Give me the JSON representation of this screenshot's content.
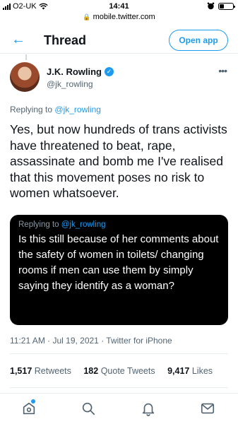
{
  "status_bar": {
    "carrier": "O2-UK",
    "time": "14:41"
  },
  "browser": {
    "url": "mobile.twitter.com"
  },
  "header": {
    "title": "Thread",
    "open_app_label": "Open app"
  },
  "tweet": {
    "author_name": "J.K. Rowling",
    "author_handle": "@jk_rowling",
    "replying_prefix": "Replying to",
    "replying_handle": "@jk_rowling",
    "text": "Yes, but now hundreds of trans activists have threatened to beat, rape, assassinate and bomb me I've realised that this movement poses no risk to women whatsoever.",
    "quoted": {
      "replying_prefix": "Replying to",
      "replying_handle": "@jk_rowling",
      "text": "Is this still because of her comments about the safety of women in toilets/ changing rooms if men can use them by simply saying they identify as a woman?"
    },
    "timestamp": "11:21 AM · Jul 19, 2021 · Twitter for iPhone",
    "stats": {
      "retweets_count": "1,517",
      "retweets_label": "Retweets",
      "quote_count": "182",
      "quote_label": "Quote Tweets",
      "likes_count": "9,417",
      "likes_label": "Likes"
    }
  },
  "colors": {
    "accent": "#1d9bf0",
    "text": "#0f1419",
    "muted": "#536471",
    "quote_bg": "#000000"
  },
  "icons": [
    "back-arrow-icon",
    "verified-icon",
    "more-icon",
    "home-icon",
    "search-icon",
    "notifications-icon",
    "messages-icon"
  ]
}
